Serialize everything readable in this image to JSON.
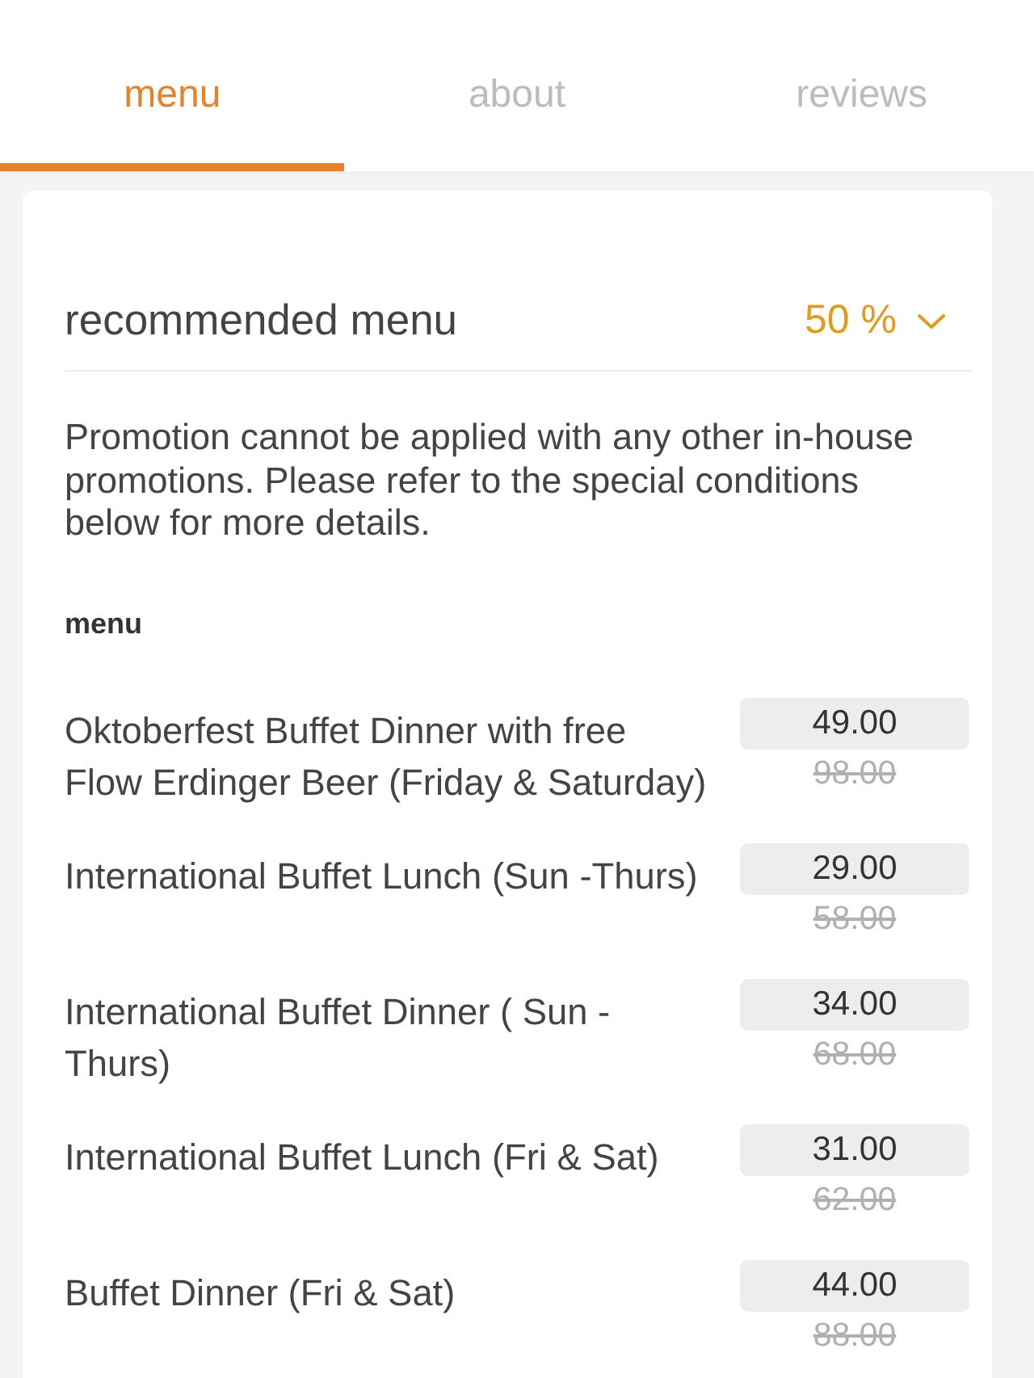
{
  "tabs": [
    {
      "label": "menu",
      "selected": true
    },
    {
      "label": "about",
      "selected": false
    },
    {
      "label": "reviews",
      "selected": false
    }
  ],
  "section": {
    "title": "recommended menu",
    "discount": "50 %"
  },
  "notice": "Promotion cannot be applied with any other in-house promotions. Please refer to the special conditions below for more details.",
  "menu_label": "menu",
  "items": [
    {
      "name": "Oktoberfest Buffet Dinner with free Flow Erdinger Beer (Friday & Saturday)",
      "price": "49.00",
      "original_price": "98.00"
    },
    {
      "name": "International Buffet Lunch (Sun -Thurs)",
      "price": "29.00",
      "original_price": "58.00"
    },
    {
      "name": "International Buffet Dinner ( Sun - Thurs)",
      "price": "34.00",
      "original_price": "68.00"
    },
    {
      "name": "International Buffet Lunch (Fri & Sat)",
      "price": "31.00",
      "original_price": "62.00"
    },
    {
      "name": "Buffet Dinner (Fri & Sat)",
      "price": "44.00",
      "original_price": "88.00"
    }
  ]
}
